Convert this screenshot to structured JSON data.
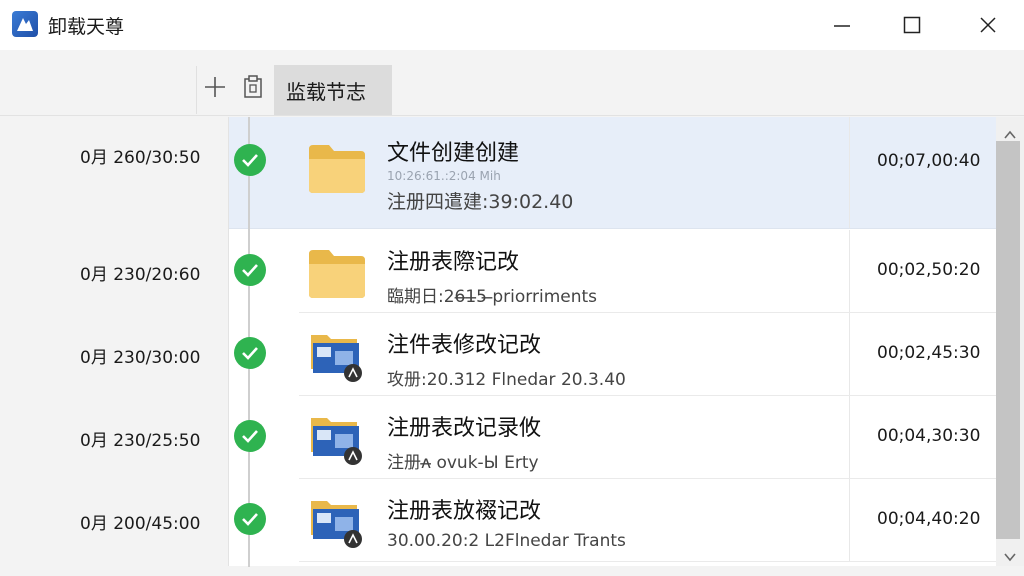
{
  "window": {
    "title": "卸载天尊",
    "icons": {
      "app": "app-logo-icon",
      "minimize": "minimize-icon",
      "maximize": "maximize-icon",
      "close": "close-icon"
    }
  },
  "toolbar": {
    "add_icon": "plus-icon",
    "clip_icon": "clipboard-icon",
    "tab_label": "监载节志"
  },
  "entries": [
    {
      "time_left": "0月 260/30:50",
      "title": "文件创建创建",
      "faint": "10:26:61.:2:04 Mih",
      "subtitle": "注册四遣建:39:02.40",
      "time_right": "00;07,00:40",
      "icon": "folder-icon",
      "selected": true
    },
    {
      "time_left": "0月 230/20:60",
      "title": "注册表際记改",
      "subtitle": "臨期日:26̶1̶5 ̶priorriments",
      "time_right": "00;02,50:20",
      "icon": "folder-icon",
      "selected": false
    },
    {
      "time_left": "0月 230/30:00",
      "title": "注件表修改记改",
      "subtitle": "攻册:20.312 Flnedar 20.3.40",
      "time_right": "00;02,45:30",
      "icon": "registry-icon",
      "selected": false
    },
    {
      "time_left": "0月 230/25:50",
      "title": "注册表改记录攸",
      "subtitle": "注册ʌ̶ ovuk-Ы Erty",
      "time_right": "00;04,30:30",
      "icon": "registry-icon",
      "selected": false
    },
    {
      "time_left": "0月 200/45:00",
      "title": "注册表放裰记改",
      "subtitle": "30.00.20:2 L2Flnedar Trants",
      "time_right": "00;04,40:20",
      "icon": "registry-icon",
      "selected": false
    }
  ],
  "colors": {
    "accent_check": "#2fb350",
    "selected_row": "#e7eef9",
    "folder": "#f3c766"
  }
}
